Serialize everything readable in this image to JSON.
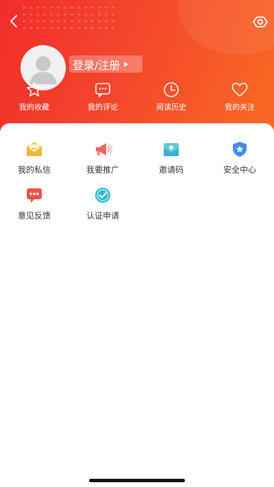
{
  "header": {
    "back_icon": "chevron-left-icon",
    "settings_icon": "eye-settings-icon",
    "login_label": "登录/注册",
    "accent_start": "#f12d2b",
    "accent_end": "#f96a22"
  },
  "quick_links": [
    {
      "label": "我的收藏",
      "icon": "star-icon"
    },
    {
      "label": "我的评论",
      "icon": "comment-icon"
    },
    {
      "label": "阅读历史",
      "icon": "clock-icon"
    },
    {
      "label": "我的关注",
      "icon": "heart-icon"
    }
  ],
  "services": [
    {
      "label": "我的私信",
      "icon": "mail-icon",
      "color": "#f2b53a"
    },
    {
      "label": "我要推广",
      "icon": "megaphone-icon",
      "color": "#f0655d"
    },
    {
      "label": "邀请码",
      "icon": "invite-envelope-icon",
      "color": "#36b6c8"
    },
    {
      "label": "安全中心",
      "icon": "shield-icon",
      "color": "#3f8cf3"
    },
    {
      "label": "意见反馈",
      "icon": "feedback-bubble-icon",
      "color": "#e9524a"
    },
    {
      "label": "认证申请",
      "icon": "verified-check-icon",
      "color": "#2fb8cf"
    }
  ]
}
